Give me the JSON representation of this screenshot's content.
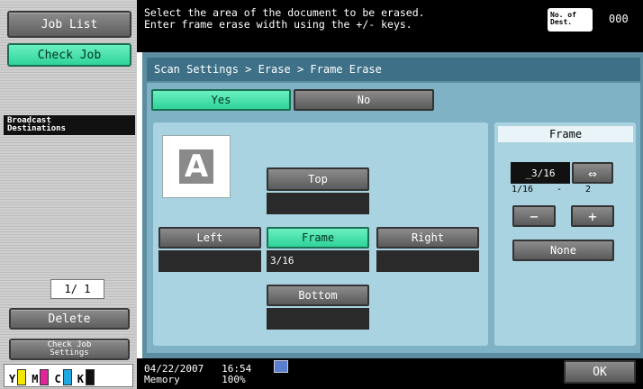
{
  "sidebar": {
    "job_list": "Job List",
    "check_job": "Check Job",
    "broadcast": "Broadcast\nDestinations",
    "page_current": "1/",
    "page_total": "1",
    "delete": "Delete",
    "check_job_settings": "Check Job\nSettings",
    "toner": [
      {
        "label": "Y",
        "color": "#f2e600"
      },
      {
        "label": "M",
        "color": "#e0249a"
      },
      {
        "label": "C",
        "color": "#20a8e0"
      },
      {
        "label": "K",
        "color": "#111111"
      }
    ]
  },
  "header": {
    "message": "Select the area of the document to be erased.\nEnter frame erase width using the +/- keys.",
    "dest_label": "No. of\nDest.",
    "dest_count": "000"
  },
  "main": {
    "breadcrumb": "Scan Settings > Erase > Frame Erase",
    "yes": "Yes",
    "no": "No",
    "top": "Top",
    "left": "Left",
    "frame": "Frame",
    "right": "Right",
    "bottom": "Bottom",
    "frame_value": "3/16",
    "doc_letter": "A"
  },
  "side": {
    "title": "Frame",
    "value": "_3/16",
    "swap_icon": "⇔",
    "range_min": "1/16",
    "range_dash": "-",
    "range_max": "2",
    "minus": "−",
    "plus": "+",
    "none": "None"
  },
  "footer": {
    "date": "04/22/2007",
    "time": "16:54",
    "memory_label": "Memory",
    "memory_value": "100%",
    "ok": "OK"
  }
}
